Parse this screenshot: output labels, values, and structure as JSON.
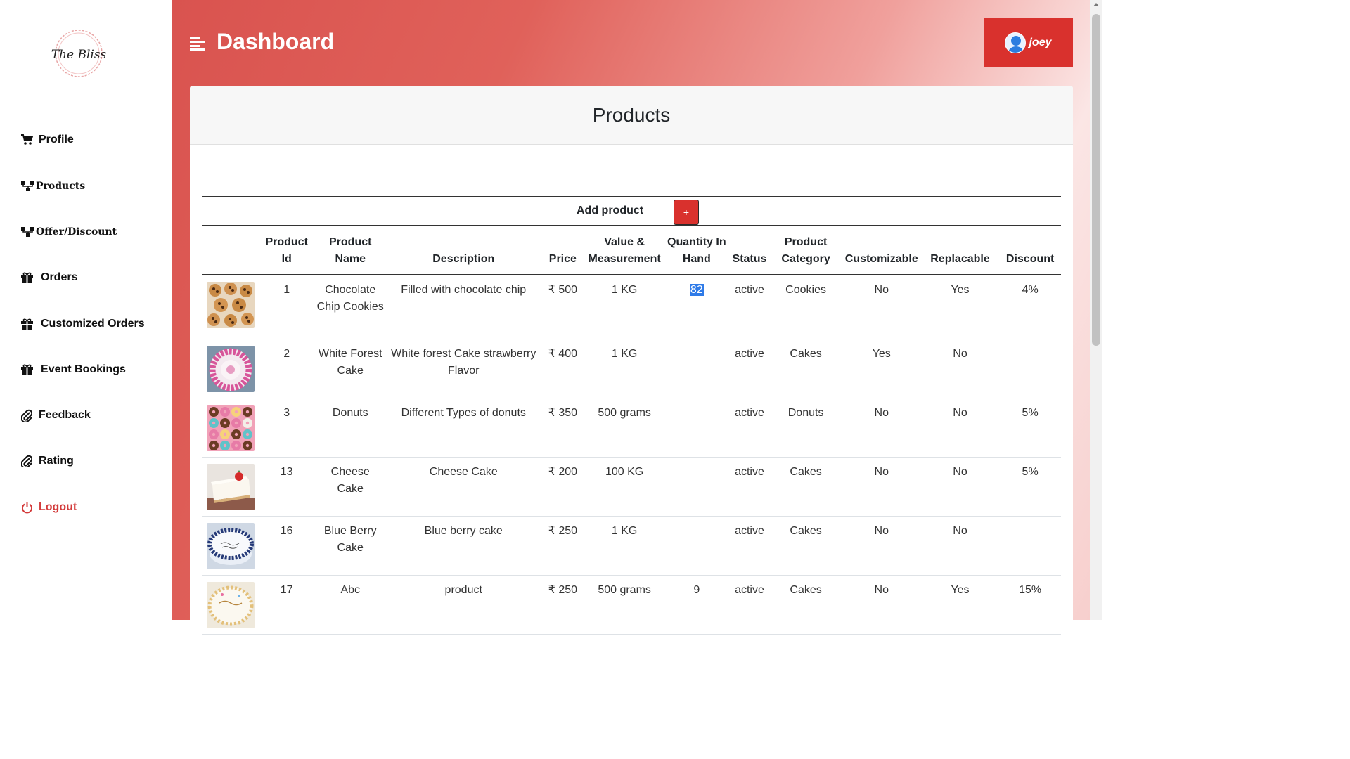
{
  "brand": {
    "logo_text": "The Bliss"
  },
  "sidebar": {
    "items": [
      {
        "label": "Profile",
        "icon": "cart-icon"
      },
      {
        "label": "Products",
        "icon": "sitemap-icon"
      },
      {
        "label": "Offer/Discount",
        "icon": "sitemap-icon"
      },
      {
        "label": "Orders",
        "icon": "gift-icon"
      },
      {
        "label": "Customized Orders",
        "icon": "gift-icon"
      },
      {
        "label": "Event Bookings",
        "icon": "gift-icon"
      },
      {
        "label": "Feedback",
        "icon": "paperclip-icon"
      },
      {
        "label": "Rating",
        "icon": "paperclip-icon"
      },
      {
        "label": "Logout",
        "icon": "power-icon"
      }
    ]
  },
  "header": {
    "title": "Dashboard",
    "user_name": "joey"
  },
  "card": {
    "title": "Products",
    "add_label": "Add product",
    "add_button": "+"
  },
  "table": {
    "columns": [
      "",
      "Product Id",
      "Product Name",
      "Description",
      "Price",
      "Value & Measurement",
      "Quantity In Hand",
      "Status",
      "Product Category",
      "Customizable",
      "Replacable",
      "Discount"
    ],
    "rows": [
      {
        "image": "cookies",
        "id": "1",
        "name": "Chocolate Chip Cookies",
        "description": "Filled with chocolate chip",
        "price": "₹ 500",
        "measure": "1 KG",
        "qty": "82",
        "status": "active",
        "category": "Cookies",
        "customizable": "No",
        "replacable": "Yes",
        "discount": "4%"
      },
      {
        "image": "white-forest-cake",
        "id": "2",
        "name": "White Forest Cake",
        "description": "White forest Cake strawberry Flavor",
        "price": "₹ 400",
        "measure": "1 KG",
        "qty": "",
        "status": "active",
        "category": "Cakes",
        "customizable": "Yes",
        "replacable": "No",
        "discount": ""
      },
      {
        "image": "donuts",
        "id": "3",
        "name": "Donuts",
        "description": "Different Types of donuts",
        "price": "₹ 350",
        "measure": "500 grams",
        "qty": "",
        "status": "active",
        "category": "Donuts",
        "customizable": "No",
        "replacable": "No",
        "discount": "5%"
      },
      {
        "image": "cheese-cake",
        "id": "13",
        "name": "Cheese Cake",
        "description": "Cheese Cake",
        "price": "₹ 200",
        "measure": "100 KG",
        "qty": "",
        "status": "active",
        "category": "Cakes",
        "customizable": "No",
        "replacable": "No",
        "discount": "5%"
      },
      {
        "image": "blueberry-cake",
        "id": "16",
        "name": "Blue Berry Cake",
        "description": "Blue berry cake",
        "price": "₹ 250",
        "measure": "1 KG",
        "qty": "",
        "status": "active",
        "category": "Cakes",
        "customizable": "No",
        "replacable": "No",
        "discount": ""
      },
      {
        "image": "birthday-cake",
        "id": "17",
        "name": "Abc",
        "description": "product",
        "price": "₹ 250",
        "measure": "500 grams",
        "qty": "9",
        "status": "active",
        "category": "Cakes",
        "customizable": "No",
        "replacable": "Yes",
        "discount": "15%"
      }
    ]
  },
  "colors": {
    "accent": "#d9312d",
    "logout": "#d33b3b",
    "selection": "#2f7be8"
  }
}
